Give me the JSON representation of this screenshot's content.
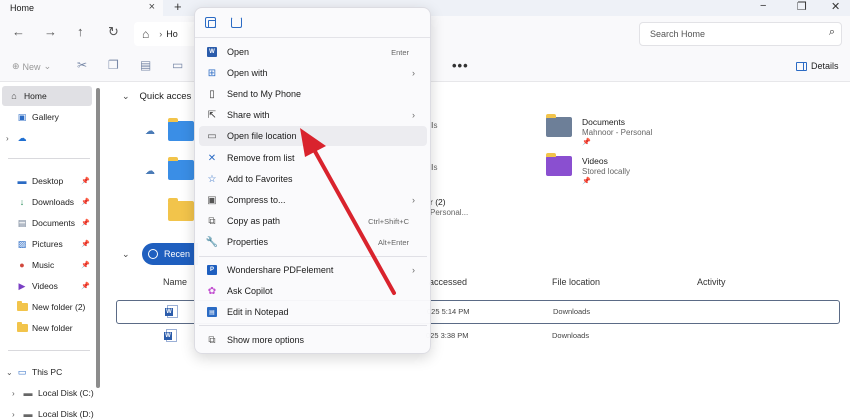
{
  "window": {
    "tab_title": "Home",
    "tab_close": "×",
    "tab_add": "+",
    "controls": {
      "minimize": "−",
      "maximize": "❐",
      "close": "✕"
    }
  },
  "nav": {
    "back": "←",
    "forward": "→",
    "up": "↑",
    "refresh": "↻",
    "breadcrumb": "Ho",
    "search_placeholder": "Search Home"
  },
  "toolbar": {
    "new_label": "New",
    "more": "•••",
    "details_label": "Details"
  },
  "sidebar": {
    "items": [
      {
        "label": "Home"
      },
      {
        "label": "Gallery"
      },
      {
        "label": ""
      },
      {
        "label": "Desktop"
      },
      {
        "label": "Downloads"
      },
      {
        "label": "Documents"
      },
      {
        "label": "Pictures"
      },
      {
        "label": "Music"
      },
      {
        "label": "Videos"
      },
      {
        "label": "New folder (2)"
      },
      {
        "label": "New folder"
      },
      {
        "label": "This PC"
      },
      {
        "label": "Local Disk (C:)"
      },
      {
        "label": "Local Disk (D:)"
      }
    ]
  },
  "main": {
    "quick_access_label": "Quick acces",
    "tiles": [
      {
        "name": "",
        "sub": "lls"
      },
      {
        "name": "Documents",
        "sub": "Mahnoor - Personal"
      },
      {
        "name": "",
        "sub": "lls"
      },
      {
        "name": "Videos",
        "sub": "Stored locally"
      },
      {
        "name": "r (2)",
        "sub": "Personal..."
      }
    ],
    "recent_label": "Recen",
    "columns": {
      "name": "Name",
      "accessed": "accessed",
      "location": "File location",
      "activity": "Activity"
    },
    "rows": [
      {
        "date": "025 5:14 PM",
        "location": "Downloads"
      },
      {
        "date": "025 3:38 PM",
        "location": "Downloads"
      }
    ]
  },
  "context_menu": {
    "items": [
      {
        "label": "Open",
        "shortcut": "Enter"
      },
      {
        "label": "Open with",
        "submenu": "›"
      },
      {
        "label": "Send to My Phone"
      },
      {
        "label": "Share with",
        "submenu": "›"
      },
      {
        "label": "Open file location"
      },
      {
        "label": "Remove from list"
      },
      {
        "label": "Add to Favorites"
      },
      {
        "label": "Compress to...",
        "submenu": "›"
      },
      {
        "label": "Copy as path",
        "shortcut": "Ctrl+Shift+C"
      },
      {
        "label": "Properties",
        "shortcut": "Alt+Enter"
      },
      {
        "label": "Wondershare PDFelement",
        "submenu": "›"
      },
      {
        "label": "Ask Copilot"
      },
      {
        "label": "Edit in Notepad"
      },
      {
        "label": "Show more options"
      }
    ]
  },
  "colors": {
    "accent": "#1f5fbf",
    "arrow": "#d9232d",
    "folder": "#f2c44b"
  }
}
